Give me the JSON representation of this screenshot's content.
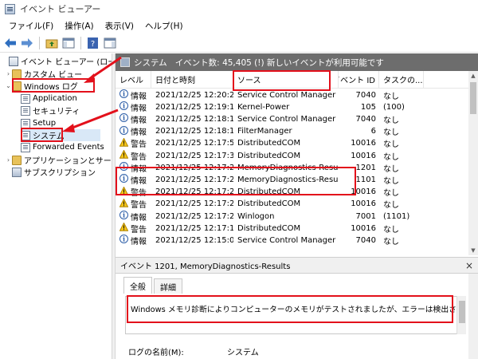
{
  "window": {
    "title": "イベント ビューアー"
  },
  "menu": [
    "ファイル(F)",
    "操作(A)",
    "表示(V)",
    "ヘルプ(H)"
  ],
  "tree": {
    "root": "イベント ビューアー (ローカル)",
    "custom_views": "カスタム ビュー",
    "windows_logs": "Windows ログ",
    "application": "Application",
    "security": "セキュリティ",
    "setup": "Setup",
    "system": "システム",
    "forwarded": "Forwarded Events",
    "app_services": "アプリケーションとサービス ロ",
    "subscriptions": "サブスクリプション"
  },
  "list_header": {
    "name": "システム",
    "info": "イベント数: 45,405 (!) 新しいイベントが利用可能です"
  },
  "columns": {
    "level": "レベル",
    "date": "日付と時刻",
    "source": "ソース",
    "event_id": "イベント ID",
    "task": "タスクの..."
  },
  "events": [
    {
      "level": "情報",
      "type": "info",
      "date": "2021/12/25 12:20:21",
      "source": "Service Control Manager",
      "id": "7040",
      "task": "なし"
    },
    {
      "level": "情報",
      "type": "info",
      "date": "2021/12/25 12:19:12",
      "source": "Kernel-Power",
      "id": "105",
      "task": "(100)"
    },
    {
      "level": "情報",
      "type": "info",
      "date": "2021/12/25 12:18:16",
      "source": "Service Control Manager",
      "id": "7040",
      "task": "なし"
    },
    {
      "level": "情報",
      "type": "info",
      "date": "2021/12/25 12:18:15",
      "source": "FilterManager",
      "id": "6",
      "task": "なし"
    },
    {
      "level": "警告",
      "type": "warn",
      "date": "2021/12/25 12:17:50",
      "source": "DistributedCOM",
      "id": "10016",
      "task": "なし"
    },
    {
      "level": "警告",
      "type": "warn",
      "date": "2021/12/25 12:17:38",
      "source": "DistributedCOM",
      "id": "10016",
      "task": "なし"
    },
    {
      "level": "情報",
      "type": "info",
      "date": "2021/12/25 12:17:29",
      "source": "MemoryDiagnostics-Results",
      "id": "1201",
      "task": "なし"
    },
    {
      "level": "情報",
      "type": "info",
      "date": "2021/12/25 12:17:29",
      "source": "MemoryDiagnostics-Results",
      "id": "1101",
      "task": "なし"
    },
    {
      "level": "警告",
      "type": "warn",
      "date": "2021/12/25 12:17:28",
      "source": "DistributedCOM",
      "id": "10016",
      "task": "なし"
    },
    {
      "level": "警告",
      "type": "warn",
      "date": "2021/12/25 12:17:28",
      "source": "DistributedCOM",
      "id": "10016",
      "task": "なし"
    },
    {
      "level": "情報",
      "type": "info",
      "date": "2021/12/25 12:17:27",
      "source": "Winlogon",
      "id": "7001",
      "task": "(1101)"
    },
    {
      "level": "警告",
      "type": "warn",
      "date": "2021/12/25 12:17:11",
      "source": "DistributedCOM",
      "id": "10016",
      "task": "なし"
    },
    {
      "level": "情報",
      "type": "info",
      "date": "2021/12/25 12:15:05",
      "source": "Service Control Manager",
      "id": "7040",
      "task": "なし"
    }
  ],
  "detail": {
    "title": "イベント 1201, MemoryDiagnostics-Results",
    "close": "×",
    "tab_general": "全般",
    "tab_details": "詳細",
    "message": "Windows メモリ診断によりコンピューターのメモリがテストされましたが、エラーは検出されませんでした",
    "log_name_label": "ログの名前(M):",
    "log_name_value": "システム"
  },
  "colors": {
    "annotation_red": "#e3101b",
    "header_gray": "#6d6d6d"
  }
}
